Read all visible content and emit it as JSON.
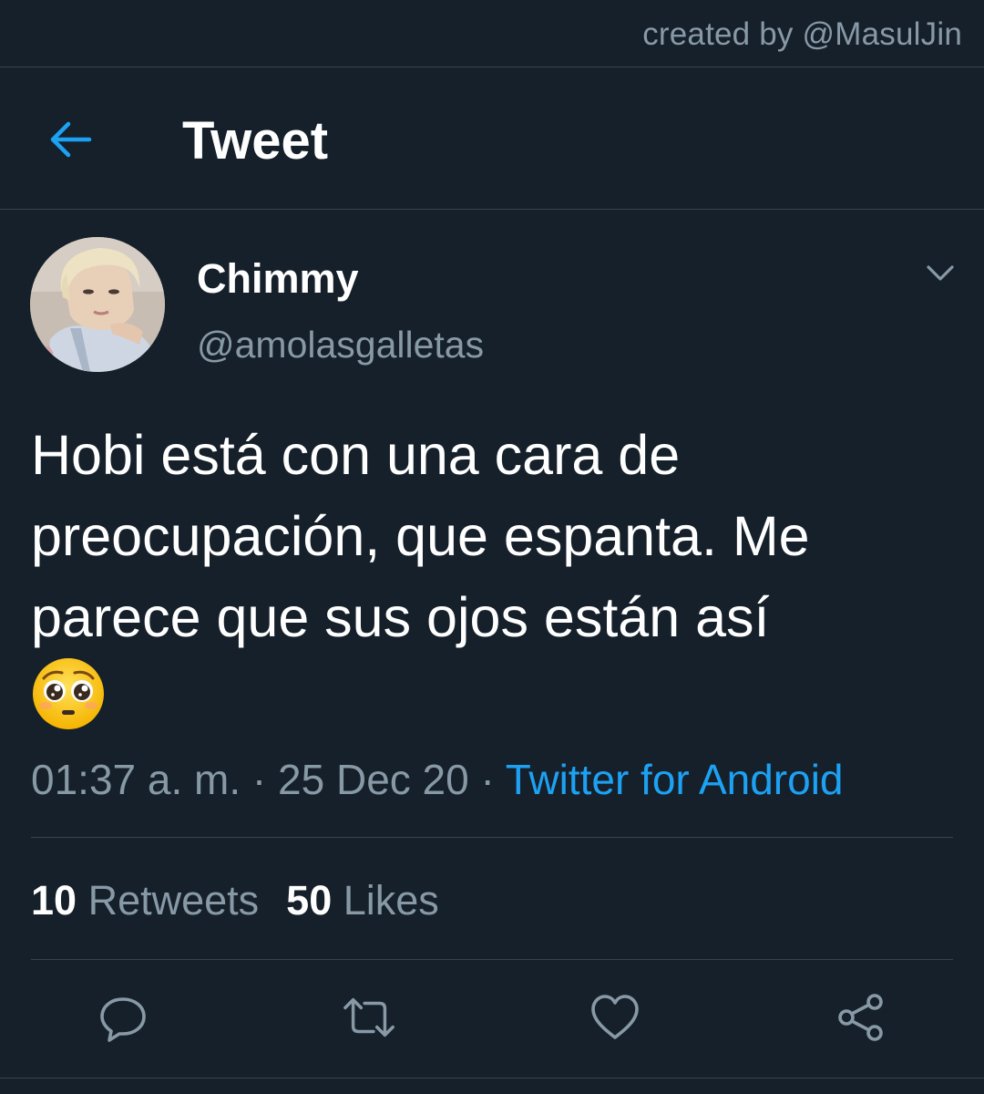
{
  "credit": "created by @MasulJin",
  "header": {
    "title": "Tweet",
    "back_icon": "arrow-left-icon"
  },
  "tweet": {
    "author": {
      "display_name": "Chimmy",
      "handle": "@amolasgalletas"
    },
    "text": "Hobi está con una cara de preocupación, que espanta. Me parece que sus ojos están así",
    "emoji": "pleading-face-emoji",
    "time": "01:37 a. m.",
    "separator": "·",
    "date": "25 Dec 20",
    "source": "Twitter for Android",
    "stats": {
      "retweets_count": "10",
      "retweets_label": "Retweets",
      "likes_count": "50",
      "likes_label": "Likes"
    }
  },
  "actions": [
    "reply-icon",
    "retweet-icon",
    "like-icon",
    "share-icon"
  ],
  "colors": {
    "background": "#15202b",
    "accent": "#1da1f2",
    "secondary_text": "#8899a6",
    "divider": "#38444d"
  }
}
